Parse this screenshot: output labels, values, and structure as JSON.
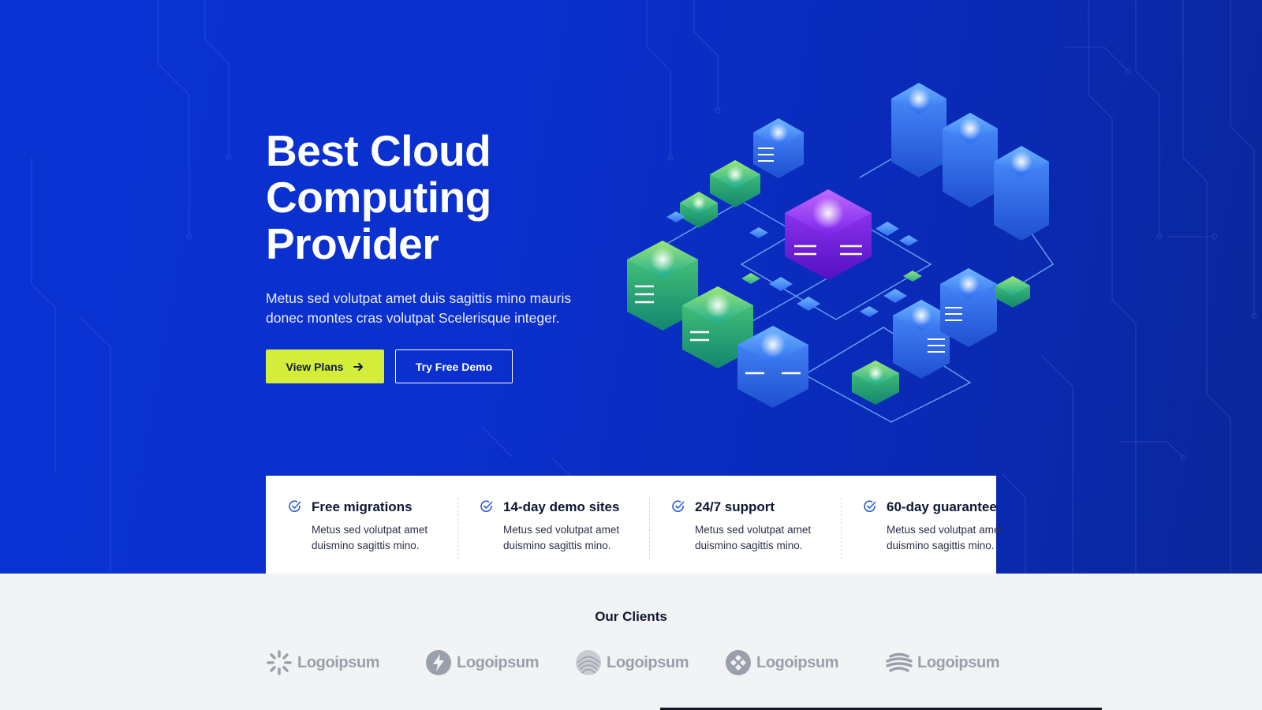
{
  "hero": {
    "title_line1": "Best Cloud",
    "title_line2": "Computing",
    "title_line3": "Provider",
    "subtitle": "Metus sed volutpat amet duis sagittis mino mauris donec montes cras volutpat Scelerisque integer.",
    "primary_button": "View Plans",
    "secondary_button": "Try Free Demo"
  },
  "features": [
    {
      "title": "Free migrations",
      "desc": "Metus sed volutpat amet duismino sagittis mino."
    },
    {
      "title": "14-day demo sites",
      "desc": "Metus sed volutpat amet duismino sagittis mino."
    },
    {
      "title": "24/7 support",
      "desc": "Metus sed volutpat amet duismino sagittis mino."
    },
    {
      "title": "60-day guarantee",
      "desc": "Metus sed volutpat amet duismino sagittis mino."
    }
  ],
  "clients": {
    "title": "Our Clients",
    "logos": [
      "Logoipsum",
      "Logoipsum",
      "Logoipsum",
      "Logoipsum",
      "Logoipsum"
    ]
  },
  "colors": {
    "hero_blue": "#0a33d4",
    "accent_lime": "#d4ec3a",
    "heading_dark": "#0e1633",
    "logo_gray": "#9aa0ab"
  }
}
